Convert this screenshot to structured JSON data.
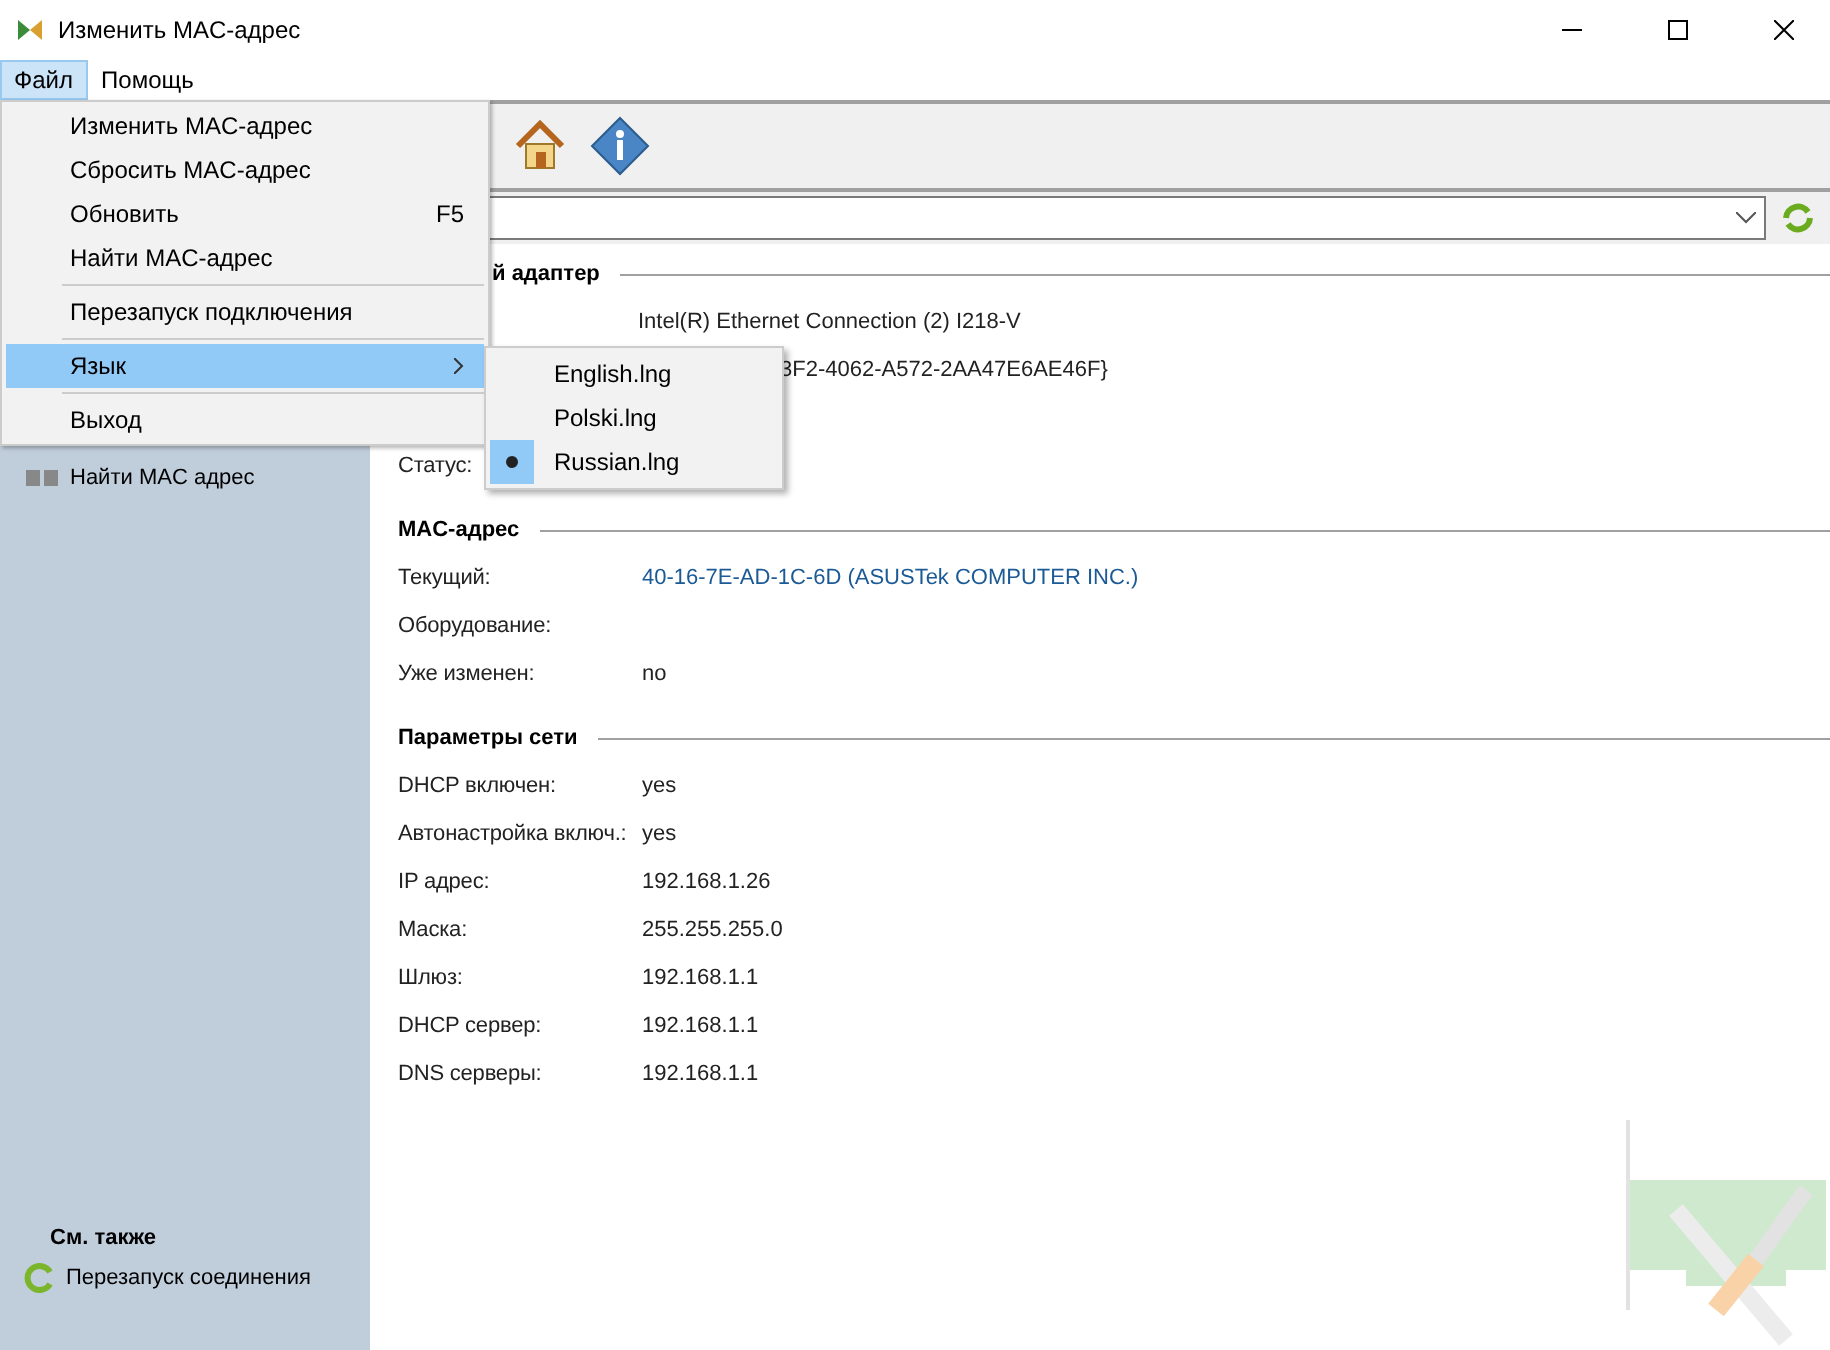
{
  "window": {
    "title": "Изменить MAC-адрес"
  },
  "menubar": [
    {
      "label": "Файл",
      "selected": true
    },
    {
      "label": "Помощь",
      "selected": false
    }
  ],
  "menu": [
    {
      "kind": "item",
      "label": "Изменить MAC-адрес",
      "selected": false
    },
    {
      "kind": "item",
      "label": "Сбросить MAC-адрес",
      "selected": false
    },
    {
      "kind": "item",
      "label": "Обновить",
      "shortcut": "F5",
      "selected": false
    },
    {
      "kind": "item",
      "label": "Найти MAC-адрес",
      "selected": false
    },
    {
      "kind": "separator"
    },
    {
      "kind": "item",
      "label": "Перезапуск подключения",
      "selected": false
    },
    {
      "kind": "separator"
    },
    {
      "kind": "submenu",
      "label": "Язык",
      "selected": true
    },
    {
      "kind": "separator"
    },
    {
      "kind": "item",
      "label": "Выход",
      "selected": false
    }
  ],
  "language_submenu": [
    {
      "label": "English.lng",
      "selected": false
    },
    {
      "label": "Polski.lng",
      "selected": false
    },
    {
      "label": "Russian.lng",
      "selected": true
    }
  ],
  "sidebar": {
    "items": [
      {
        "label": "Найти MAC адрес"
      }
    ],
    "see_also": {
      "title": "См. также",
      "items": [
        {
          "label": "Перезапуск соединения"
        }
      ]
    }
  },
  "sections": [
    {
      "title": "й адаптер",
      "kind": "partial",
      "rows": [
        {
          "kind": "plain",
          "value": "Intel(R) Ethernet Connection (2) I218-V"
        },
        {
          "kind": "partial",
          "value": "3F2-4062-A572-2AA47E6AE46F}"
        },
        {
          "kind": "gap",
          "label": "Статус:"
        }
      ]
    },
    {
      "title": "MAC-адрес",
      "kind": "full",
      "rows": [
        {
          "kind": "link",
          "label": "Текущий:",
          "value": "40-16-7E-AD-1C-6D (ASUSTek COMPUTER INC.)"
        },
        {
          "kind": "plain",
          "label": "Оборудование:"
        },
        {
          "kind": "plain",
          "label": "Уже изменен:",
          "value": "no"
        }
      ]
    },
    {
      "title": "Параметры сети",
      "kind": "full",
      "rows": [
        {
          "kind": "plain",
          "label": "DHCP включен:",
          "value": "yes"
        },
        {
          "kind": "plain",
          "label": "Автонастройка включ.:",
          "value": "yes"
        },
        {
          "kind": "plain",
          "label": "IP адрес:",
          "value": "192.168.1.26"
        },
        {
          "kind": "plain",
          "label": "Маска:",
          "value": "255.255.255.0"
        },
        {
          "kind": "plain",
          "label": "Шлюз:",
          "value": "192.168.1.1"
        },
        {
          "kind": "plain",
          "label": "DHCP сервер:",
          "value": "192.168.1.1"
        },
        {
          "kind": "plain",
          "label": "DNS серверы:",
          "value": "192.168.1.1"
        }
      ]
    }
  ]
}
